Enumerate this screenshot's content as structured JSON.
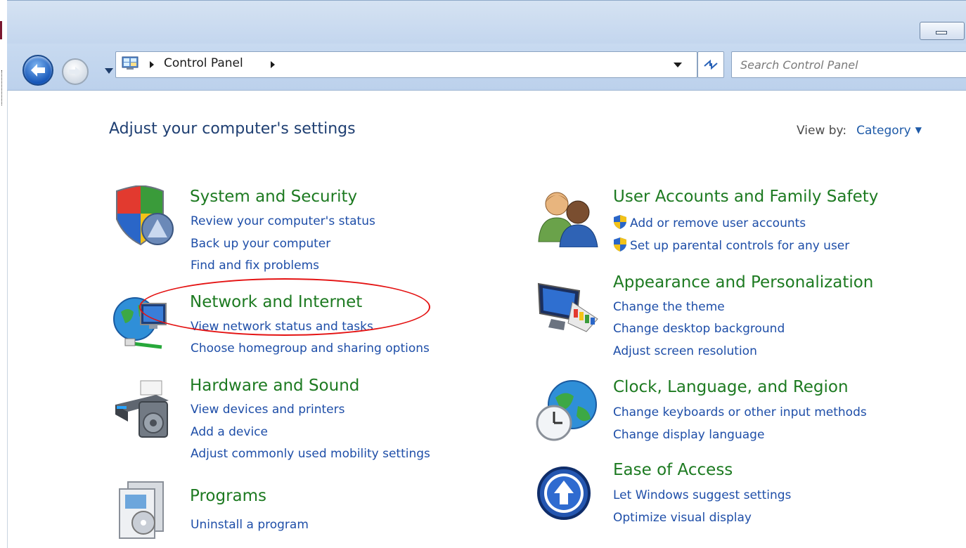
{
  "window": {
    "address_crumb": "Control Panel",
    "search_placeholder": "Search Control Panel"
  },
  "header": {
    "page_title": "Adjust your computer's settings",
    "view_by_label": "View by:",
    "view_by_value": "Category"
  },
  "left_column": [
    {
      "title": "System and Security",
      "icon": "shield-security-icon",
      "tasks": [
        "Review your computer's status",
        "Back up your computer",
        "Find and fix problems"
      ]
    },
    {
      "title": "Network and Internet",
      "icon": "network-globe-icon",
      "tasks": [
        "View network status and tasks",
        "Choose homegroup and sharing options"
      ]
    },
    {
      "title": "Hardware and Sound",
      "icon": "printer-speaker-icon",
      "tasks": [
        "View devices and printers",
        "Add a device",
        "Adjust commonly used mobility settings"
      ]
    },
    {
      "title": "Programs",
      "icon": "programs-box-icon",
      "tasks": [
        "Uninstall a program"
      ]
    }
  ],
  "right_column": [
    {
      "title": "User Accounts and Family Safety",
      "icon": "users-icon",
      "tasks": [
        "Add or remove user accounts",
        "Set up parental controls for any user"
      ]
    },
    {
      "title": "Appearance and Personalization",
      "icon": "monitor-palette-icon",
      "tasks": [
        "Change the theme",
        "Change desktop background",
        "Adjust screen resolution"
      ]
    },
    {
      "title": "Clock, Language, and Region",
      "icon": "clock-globe-icon",
      "tasks": [
        "Change keyboards or other input methods",
        "Change display language"
      ]
    },
    {
      "title": "Ease of Access",
      "icon": "ease-of-access-icon",
      "tasks": [
        "Let Windows suggest settings",
        "Optimize visual display"
      ]
    }
  ],
  "colors": {
    "category_title": "#1d7a21",
    "task_link": "#1e4ea8",
    "page_title": "#1f3f72",
    "highlight_ellipse": "#e41212"
  }
}
